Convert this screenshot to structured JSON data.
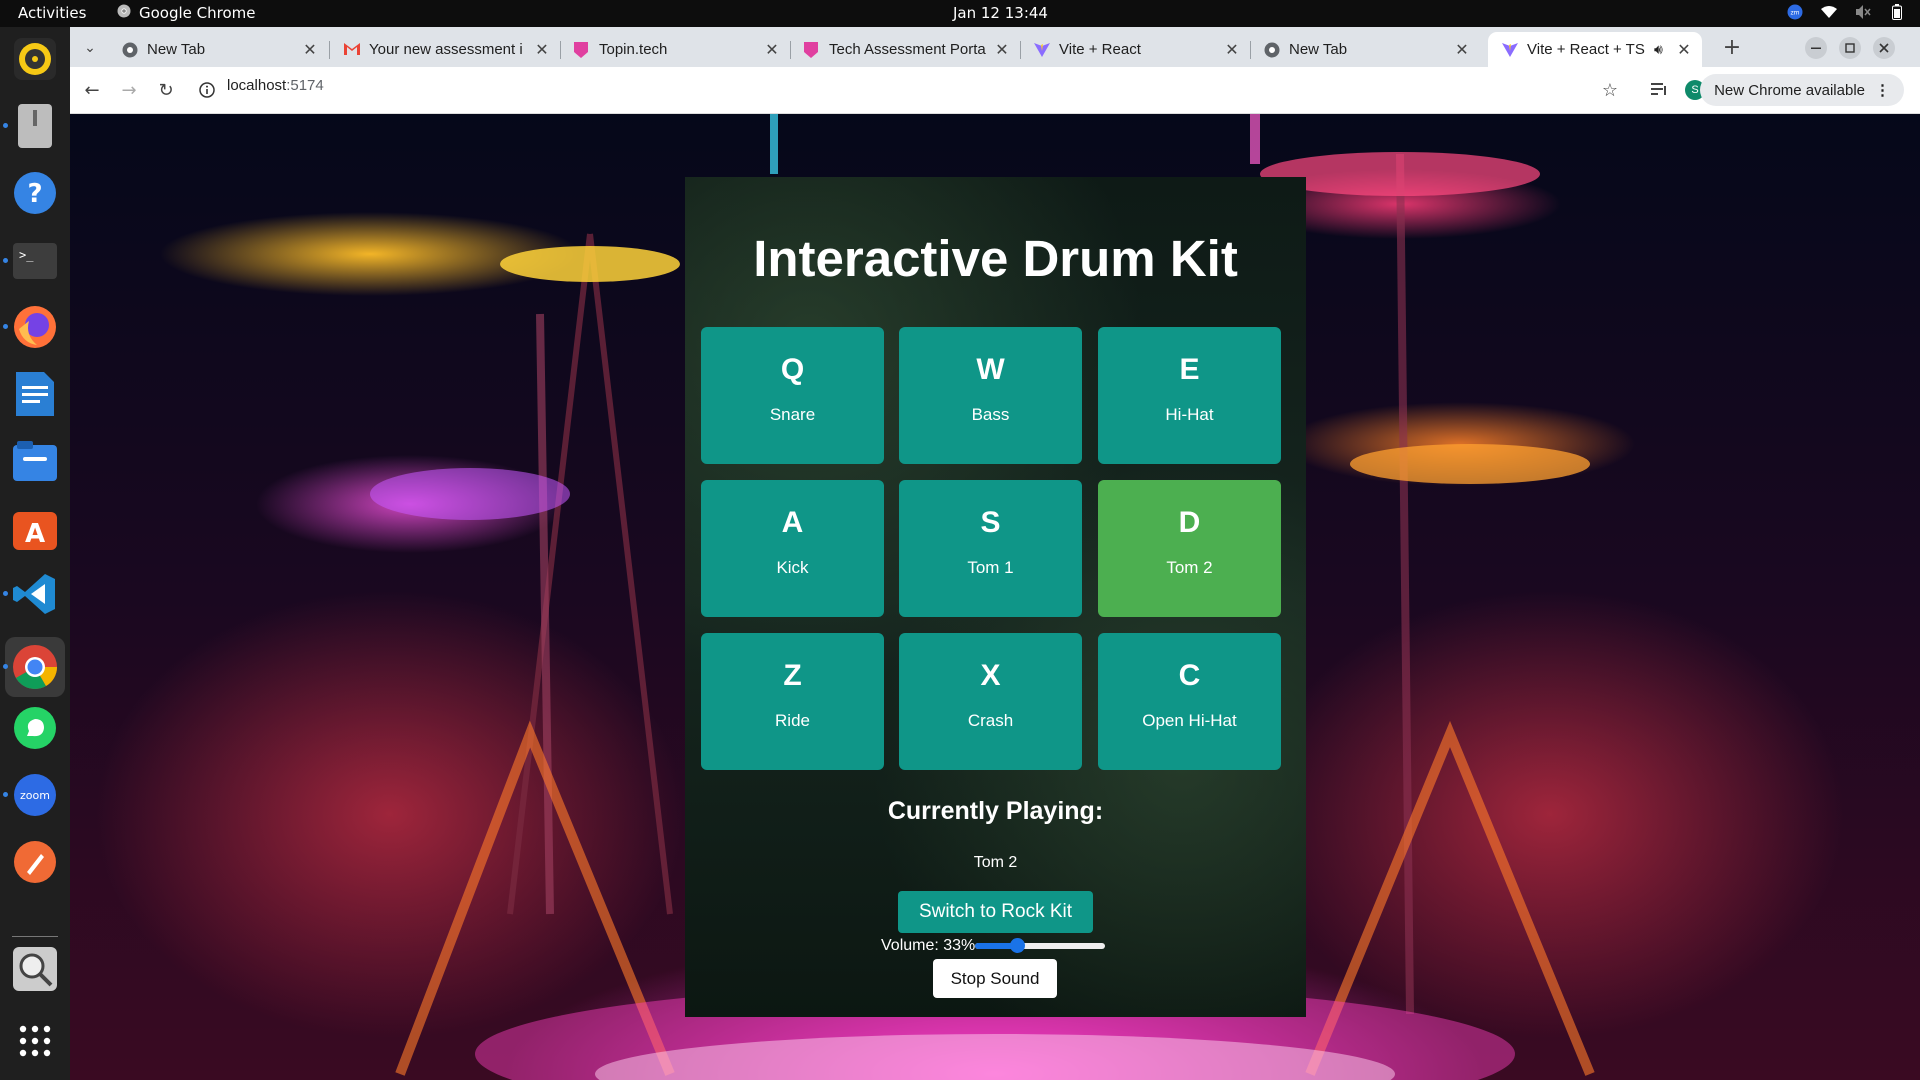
{
  "topbar": {
    "activities": "Activities",
    "app_name": "Google Chrome",
    "datetime": "Jan 12  13:44",
    "tray_icons": [
      "zoom-tray-icon",
      "wifi-icon",
      "volume-muted-icon",
      "battery-icon"
    ]
  },
  "dock": {
    "items": [
      "rhythmbox-icon",
      "disk-icon",
      "help-icon",
      "terminal-icon",
      "firefox-icon",
      "writer-icon",
      "files-icon",
      "app-center-icon",
      "vscode-icon",
      "chrome-icon",
      "whatsapp-icon",
      "zoom-icon",
      "pen-tool-icon",
      "magnifier-icon",
      "show-apps-icon"
    ]
  },
  "browser": {
    "tabs": [
      {
        "title": "New Tab",
        "icon": "chrome-icon",
        "active": false
      },
      {
        "title": "Your new assessment i",
        "icon": "gmail-icon",
        "active": false
      },
      {
        "title": "Topin.tech",
        "icon": "topin-icon",
        "active": false
      },
      {
        "title": "Tech Assessment Porta",
        "icon": "topin-icon",
        "active": false
      },
      {
        "title": "Vite + React",
        "icon": "vite-icon",
        "active": false
      },
      {
        "title": "New Tab",
        "icon": "chrome-icon",
        "active": false
      },
      {
        "title": "Vite + React + TS",
        "icon": "vite-icon",
        "active": true
      }
    ],
    "new_tab_symbol": "+",
    "url_host": "localhost",
    "url_port": ":5174",
    "profile_initial": "S",
    "update_label": "New Chrome available"
  },
  "app": {
    "title": "Interactive Drum Kit",
    "pads": [
      {
        "key": "Q",
        "label": "Snare",
        "active": false
      },
      {
        "key": "W",
        "label": "Bass",
        "active": false
      },
      {
        "key": "E",
        "label": "Hi-Hat",
        "active": false
      },
      {
        "key": "A",
        "label": "Kick",
        "active": false
      },
      {
        "key": "S",
        "label": "Tom 1",
        "active": false
      },
      {
        "key": "D",
        "label": "Tom 2",
        "active": true
      },
      {
        "key": "Z",
        "label": "Ride",
        "active": false
      },
      {
        "key": "X",
        "label": "Crash",
        "active": false
      },
      {
        "key": "C",
        "label": "Open Hi-Hat",
        "active": false
      }
    ],
    "currently_playing_heading": "Currently Playing:",
    "currently_playing": "Tom 2",
    "switch_kit_label": "Switch to Rock Kit",
    "volume_label": "Volume: 33%",
    "volume_fraction": 0.33,
    "stop_label": "Stop Sound",
    "colors": {
      "pad": "#0f9688",
      "pad_active": "#4caf50",
      "slider": "#1a73e8"
    }
  }
}
